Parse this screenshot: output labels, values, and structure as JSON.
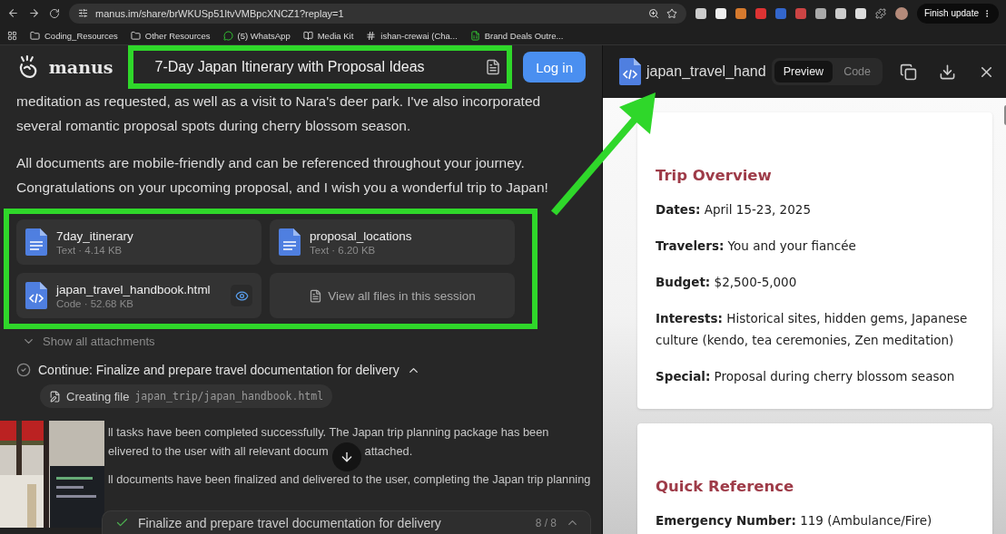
{
  "browser": {
    "url": "manus.im/share/brWKUSp51ltvVMBpcXNCZ1?replay=1",
    "update_button": "Finish update",
    "bookmarks": [
      {
        "label": "Coding_Resources",
        "kind": "folder"
      },
      {
        "label": "Other Resources",
        "kind": "folder"
      },
      {
        "label": "(5) WhatsApp",
        "kind": "chat"
      },
      {
        "label": "Media Kit",
        "kind": "page"
      },
      {
        "label": "ishan-crewai (Cha...",
        "kind": "slack"
      },
      {
        "label": "Brand Deals Outre...",
        "kind": "sheet"
      }
    ]
  },
  "header": {
    "logo": "manus",
    "title": "7-Day Japan Itinerary with Proposal Ideas",
    "login": "Log in"
  },
  "chat": {
    "paragraphs": [
      "meditation as requested, as well as a visit to Nara's deer park. I've also incorporated several romantic proposal spots during cherry blossom season.",
      "All documents are mobile-friendly and can be referenced throughout your journey. Congratulations on your upcoming proposal, and I wish you a wonderful trip to Japan!"
    ],
    "files": [
      {
        "name": "7day_itinerary",
        "meta": "Text · 4.14 KB",
        "kind": "text",
        "preview": false
      },
      {
        "name": "proposal_locations",
        "meta": "Text · 6.20 KB",
        "kind": "text",
        "preview": false
      },
      {
        "name": "japan_travel_handbook.html",
        "meta": "Code · 52.68 KB",
        "kind": "code",
        "preview": true
      }
    ],
    "view_all": "View all files in this session",
    "show_attachments": "Show all attachments",
    "step": {
      "label": "Continue: Finalize and prepare travel documentation for delivery",
      "done": true,
      "expanded": true
    },
    "action": {
      "verb": "Creating file",
      "path": "japan_trip/japan_handbook.html"
    },
    "messages": [
      {
        "lines": [
          [
            "ll tasks have been completed successfully. The Japan trip planning package has been"
          ],
          [
            "elivered to the user with all relevant docum",
            "attached."
          ]
        ]
      },
      {
        "lines": [
          [
            "ll documents have been finalized and delivered to the user, completing the Japan trip planning"
          ]
        ]
      }
    ],
    "task": {
      "label": "Finalize and prepare travel documentation for delivery",
      "progress": "8 / 8",
      "done": true
    }
  },
  "preview": {
    "file": "japan_travel_hand",
    "tabs": [
      {
        "label": "Preview",
        "selected": true
      },
      {
        "label": "Code",
        "selected": false
      }
    ],
    "sections": [
      {
        "heading": "Trip Overview",
        "lines": [
          "**Dates:** April 15-23, 2025",
          "**Travelers:** You and your fiancée",
          "**Budget:** $2,500-5,000",
          "**Interests:** Historical sites, hidden gems, Japanese culture (kendo, tea ceremonies, Zen meditation)",
          "**Special:** Proposal during cherry blossom season"
        ]
      },
      {
        "heading": "Quick Reference",
        "lines": [
          "**Emergency Number:** 119 (Ambulance/Fire)"
        ]
      }
    ]
  },
  "annotations": {
    "title_frame": true,
    "files_frame": true,
    "arrow": true
  }
}
